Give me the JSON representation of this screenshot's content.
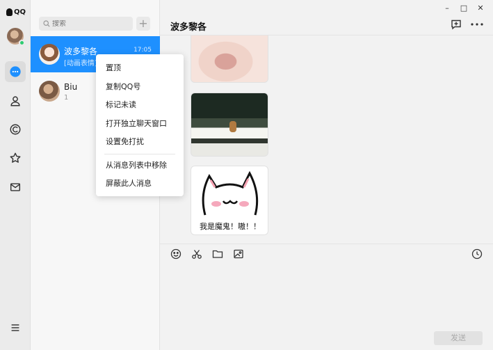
{
  "app": {
    "logo_text": "QQ"
  },
  "rail": {
    "items": [
      "chat-icon",
      "contacts-icon",
      "channel-icon",
      "favorites-icon",
      "mail-icon",
      "menu-icon"
    ]
  },
  "search": {
    "placeholder": "搜索"
  },
  "add_label": "+",
  "conversations": [
    {
      "name": "波多黎各",
      "preview": "[动画表情]",
      "time": "17:05"
    },
    {
      "name": "Biu",
      "preview": "1"
    }
  ],
  "chat": {
    "title": "波多黎各",
    "sticker_caption": "我是魔鬼！嗷！！"
  },
  "window": {
    "minimize": "–",
    "maximize": "□",
    "close": "✕"
  },
  "send_label": "发送",
  "context_menu": {
    "group1": [
      "置顶",
      "复制QQ号",
      "标记未读",
      "打开独立聊天窗口",
      "设置免打扰"
    ],
    "group2": [
      "从消息列表中移除",
      "屏蔽此人消息"
    ]
  },
  "colors": {
    "accent": "#1e90ff",
    "online": "#2ecc71"
  }
}
